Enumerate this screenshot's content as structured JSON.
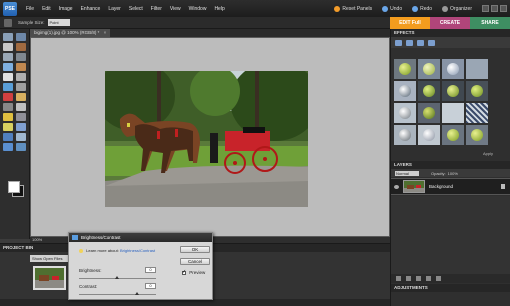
{
  "app": {
    "logo_text": "PSE"
  },
  "menu": [
    "File",
    "Edit",
    "Image",
    "Enhance",
    "Layer",
    "Select",
    "Filter",
    "View",
    "Window",
    "Help"
  ],
  "menu_right": {
    "reset_panels": "Reset Panels",
    "undo": "Undo",
    "redo": "Redo",
    "organizer": "Organizer"
  },
  "options": {
    "sample_size_label": "Sample Size:",
    "sample_size_value": "Point Sample"
  },
  "modes": {
    "edit": "EDIT Full",
    "create": "CREATE",
    "share": "SHARE"
  },
  "document": {
    "tab_title": "bigimg(1).jpg @ 100% (RGB/8) *",
    "zoom": "100%"
  },
  "project_bin": {
    "title": "PROJECT BIN",
    "show": "Show Open Files"
  },
  "dialog": {
    "title": "Brightness/Contrast",
    "learn_prefix": "Learn more about:",
    "learn_link": "Brightness/Contrast",
    "ok": "OK",
    "cancel": "Cancel",
    "preview": "Preview",
    "brightness_label": "Brightness:",
    "brightness_value": "0",
    "contrast_label": "Contrast:",
    "contrast_value": "0"
  },
  "effects": {
    "title": "EFFECTS",
    "apply": "Apply"
  },
  "layers": {
    "title": "LAYERS",
    "mode": "Normal",
    "opacity_label": "Opacity:",
    "opacity_value": "100%",
    "layer_name": "Background"
  },
  "adjustments": {
    "title": "ADJUSTMENTS"
  }
}
